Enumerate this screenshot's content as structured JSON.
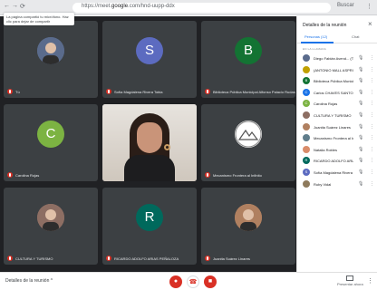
{
  "browser": {
    "url_prefix": "https://meet.",
    "url_domain": "google",
    "url_suffix": ".com/hnd-uupp-ddx",
    "address_placeholder": "Buscar",
    "toast": "La página compartió tu micrófono. Haz clic para dejar de compartir"
  },
  "tiles": [
    {
      "name": "Tú",
      "avatar_letter": "",
      "avatar_type": "photo",
      "color": "#5a6b8c"
    },
    {
      "name": "Sofía Magdalena Rivera Tobia",
      "avatar_letter": "S",
      "avatar_type": "letter",
      "color": "#5c6bc0"
    },
    {
      "name": "Biblioteca Pública Municipal Alfonso Palacio Rudas",
      "avatar_letter": "B",
      "avatar_type": "letter",
      "color": "#137333"
    },
    {
      "name": "Carolina Rojas",
      "avatar_letter": "C",
      "avatar_type": "letter",
      "color": "#7cb342"
    },
    {
      "name": "",
      "avatar_letter": "",
      "avatar_type": "video",
      "color": ""
    },
    {
      "name": "Mecanismo Frontera al Infinito",
      "avatar_letter": "",
      "avatar_type": "logo",
      "color": "#ffffff"
    },
    {
      "name": "CULTURA Y TURISMO",
      "avatar_letter": "",
      "avatar_type": "photo",
      "color": "#8d6e63"
    },
    {
      "name": "RICARDO ADOLFO ARIAS PEÑALOZA",
      "avatar_letter": "R",
      "avatar_type": "letter",
      "color": "#00695c"
    },
    {
      "name": "Juanita Suárez Linares",
      "avatar_letter": "",
      "avatar_type": "photo",
      "color": "#b08060"
    }
  ],
  "bottombar": {
    "meeting_details": "Detalles de la reunión",
    "chevron": "^",
    "mic_icon": "mic-off-icon",
    "cam_icon": "camera-off-icon",
    "end_icon": "end-call-icon",
    "present_label": "Presentar ahora",
    "more": "⋮"
  },
  "panel": {
    "title": "Detalles de la reunión",
    "close": "×",
    "tab_people": "Personas (12)",
    "tab_chat": "Chat",
    "section_label": "EN LA LLAMADA",
    "participants": [
      {
        "name": "Diego Fabián Avend... (Tú)",
        "letter": "",
        "color": "#5a6b8c"
      },
      {
        "name": "(ANTONIO MALL ASPRILLA)",
        "letter": "",
        "color": "#c0a000"
      },
      {
        "name": "Biblioteca Pública Municipal",
        "letter": "B",
        "color": "#137333"
      },
      {
        "name": "Carlos CHAVES SANTOS",
        "letter": "C",
        "color": "#1a73e8"
      },
      {
        "name": "Carolina Rojas",
        "letter": "C",
        "color": "#7cb342"
      },
      {
        "name": "CULTURA Y TURISMO",
        "letter": "",
        "color": "#8d6e63"
      },
      {
        "name": "Juanita Suárez Linares",
        "letter": "",
        "color": "#b08060"
      },
      {
        "name": "Mecanismo Frontera al Infinito",
        "letter": "",
        "color": "#607d8b"
      },
      {
        "name": "Natalia Robles",
        "letter": "",
        "color": "#d98c6a"
      },
      {
        "name": "RICARDO ADOLFO ARIAS...",
        "letter": "R",
        "color": "#00695c"
      },
      {
        "name": "Sofía Magdalena Rivera Tobia",
        "letter": "S",
        "color": "#5c6bc0"
      },
      {
        "name": "Ruby Vidal",
        "letter": "",
        "color": "#8e7a5c"
      }
    ]
  }
}
